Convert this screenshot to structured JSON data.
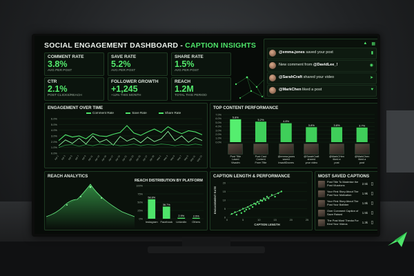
{
  "dashboard": {
    "title_main": "SOCIAL ENGAGEMENT DASHBOARD - ",
    "title_accent": "CAPTION INSIGHTS"
  },
  "kpis": [
    {
      "label": "COMMENT RATE",
      "value": "3.8%",
      "sub": "AVG PER POST"
    },
    {
      "label": "SAVE RATE",
      "value": "5.2%",
      "sub": "AVG PER POST"
    },
    {
      "label": "SHARE RATE",
      "value": "1.5%",
      "sub": "AVG PER POST"
    },
    {
      "label": "CTR",
      "value": "2.1%",
      "sub": "POST CLICKS/REACH"
    },
    {
      "label": "FOLLOWER GROWTH",
      "value": "+1,245",
      "sub": "+12% THIS MONTH"
    },
    {
      "label": "REACH",
      "value": "1.2M",
      "sub": "TOTAL THIS PERIOD"
    }
  ],
  "notifications": [
    {
      "user": "@emma.jones",
      "text": " saved your post",
      "icon": "bookmark-icon"
    },
    {
      "user": "",
      "text": "New comment from ",
      "user_after": "@DavidLee_!",
      "icon": "comment-icon"
    },
    {
      "user": "@SarahCraft",
      "text": " shared your video",
      "icon": "share-icon"
    },
    {
      "user": "@MarkChen",
      "text": " liked a post",
      "icon": "heart-icon"
    }
  ],
  "engagement": {
    "title": "ENGAGEMENT OVER TIME",
    "legend": [
      "Comment Rate",
      "Save Rate",
      "Share Rate"
    ],
    "y_ticks": [
      "6.0%",
      "5.0%",
      "4.0%",
      "3.0%",
      "2.0%",
      "1.0%",
      "0.0%"
    ],
    "x_ticks": [
      "Apr 1",
      "Apr 3",
      "Apr 5",
      "Apr 7",
      "Apr 9",
      "Apr 11",
      "Apr 13",
      "Apr 15",
      "Apr 17",
      "Apr 19",
      "Apr 21",
      "Apr 23",
      "Apr 25",
      "Apr 27",
      "Apr 29",
      "May 1",
      "May 3",
      "May 5",
      "May 7",
      "May 9",
      "May 11",
      "May 13"
    ]
  },
  "top_content": {
    "title": "TOP CONTENT PERFORMANCE",
    "y_ticks": [
      "7.0%",
      "6.0%",
      "5.0%",
      "4.0%",
      "3.0%",
      "2.0%",
      "1.0%",
      "0.0%"
    ],
    "bar_labels": [
      "5.8%",
      "5.2%",
      "4.8%",
      "3.8%",
      "3.8%",
      "3.7%"
    ],
    "posts": [
      "Post Title Lased\nVisadm",
      "Post Caut Content\nFrom Title",
      "@emma.jones saved\nInsadtDoores",
      "@SarahCraft shared\nyour video",
      "@MarkCHen liked a\npost",
      "@MarkChen liked a\npost"
    ]
  },
  "reach_analytics": {
    "title": "REACH ANALYTICS"
  },
  "reach_platform": {
    "title": "REACH DISTRIBUTION BY PLATFORM",
    "y_ticks": [
      "100%",
      "75%",
      "50%",
      "25%",
      "0%"
    ],
    "value_labels": [
      "58.8%",
      "36.7%",
      "2.9%",
      "2.5%"
    ],
    "platforms": [
      "Instagram",
      "Facebook",
      "LinkedIn",
      "Others"
    ]
  },
  "caption_perf": {
    "title": "CAPTION LENGTH & PERFORMANCE",
    "ylabel": "ENGAGEMENT RATE",
    "xlabel": "CAPTION LENGTH",
    "x_ticks": [
      "0",
      "5",
      "10",
      "15",
      "20",
      "25"
    ],
    "y_ticks": [
      "20",
      "15",
      "10",
      "5",
      "0"
    ]
  },
  "saved_captions": {
    "title": "MOST SAVED CAPTIONS",
    "items": [
      {
        "text": "Post Title To Maximise the\nPost Vluzzions",
        "count": "2.5k"
      },
      {
        "text": "Your First Story About The\nPost Your Motivation",
        "count": "1.9k"
      },
      {
        "text": "Your First Story About The\nPost Your Bathber",
        "count": "1.8k"
      },
      {
        "text": "Over Comment Caption of\nSave Raised",
        "count": "1.5k"
      },
      {
        "text": "The Post Most Thecka For\nKind Your Videos",
        "count": "1.3k"
      }
    ]
  },
  "chart_data": [
    {
      "type": "line",
      "title": "ENGAGEMENT OVER TIME",
      "x": [
        "Apr 1",
        "Apr 3",
        "Apr 5",
        "Apr 7",
        "Apr 9",
        "Apr 11",
        "Apr 13",
        "Apr 15",
        "Apr 17",
        "Apr 19",
        "Apr 21",
        "Apr 23",
        "Apr 25",
        "Apr 27",
        "Apr 29",
        "May 1",
        "May 3",
        "May 5",
        "May 7",
        "May 9",
        "May 11",
        "May 13"
      ],
      "series": [
        {
          "name": "Comment Rate",
          "values": [
            2.2,
            3.2,
            2.8,
            3.0,
            2.5,
            3.4,
            3.0,
            2.9,
            3.3,
            3.6,
            4.8,
            3.5,
            3.1,
            3.7,
            4.2,
            3.6,
            4.6,
            3.9,
            3.4,
            3.9,
            3.7,
            3.2
          ]
        },
        {
          "name": "Save Rate",
          "values": [
            1.3,
            2.3,
            1.7,
            2.6,
            1.6,
            3.0,
            1.9,
            2.4,
            1.4,
            2.9,
            2.1,
            2.6,
            1.8,
            2.8,
            2.0,
            2.5,
            3.8,
            2.2,
            3.0,
            1.9,
            2.7,
            2.2
          ]
        },
        {
          "name": "Share Rate",
          "values": [
            1.0,
            1.4,
            1.5,
            1.2,
            1.5,
            1.3,
            1.6,
            1.4,
            1.5,
            1.3,
            1.4,
            1.6,
            1.3,
            1.5,
            1.4,
            1.6,
            1.5,
            1.3,
            1.5,
            1.4,
            1.6,
            1.4
          ]
        }
      ],
      "ylim": [
        0,
        6
      ]
    },
    {
      "type": "bar",
      "title": "TOP CONTENT PERFORMANCE",
      "categories": [
        "Post Title Lased Visadm",
        "Post Caut Content From Title",
        "@emma.jones saved InsadtDoores",
        "@SarahCraft shared your video",
        "@MarkCHen liked a post",
        "@MarkChen liked a post"
      ],
      "values": [
        5.8,
        5.2,
        4.8,
        3.8,
        3.8,
        3.7
      ],
      "ylim": [
        0,
        7
      ]
    },
    {
      "type": "bar",
      "title": "REACH DISTRIBUTION BY PLATFORM",
      "categories": [
        "Instagram",
        "Facebook",
        "LinkedIn",
        "Others"
      ],
      "values": [
        58.8,
        36.7,
        2.9,
        2.5
      ],
      "ylim": [
        0,
        100
      ]
    },
    {
      "type": "scatter",
      "title": "CAPTION LENGTH & PERFORMANCE",
      "xlabel": "CAPTION LENGTH",
      "ylabel": "ENGAGEMENT RATE",
      "x": [
        1.5,
        2.5,
        3,
        4,
        4.5,
        5,
        5.5,
        6,
        6.5,
        7,
        7.5,
        8,
        8.5,
        9,
        9.5,
        10,
        10.5,
        11,
        11.5,
        12,
        12.5,
        13,
        14,
        15,
        16,
        17
      ],
      "y": [
        2,
        3,
        1.5,
        4,
        2.5,
        5,
        3.5,
        4.5,
        6,
        5,
        7,
        6,
        8,
        7.5,
        9,
        8,
        10,
        9.5,
        11,
        10,
        12,
        11,
        13,
        12,
        14,
        15
      ],
      "xlim": [
        0,
        25
      ],
      "ylim": [
        0,
        20
      ]
    }
  ]
}
